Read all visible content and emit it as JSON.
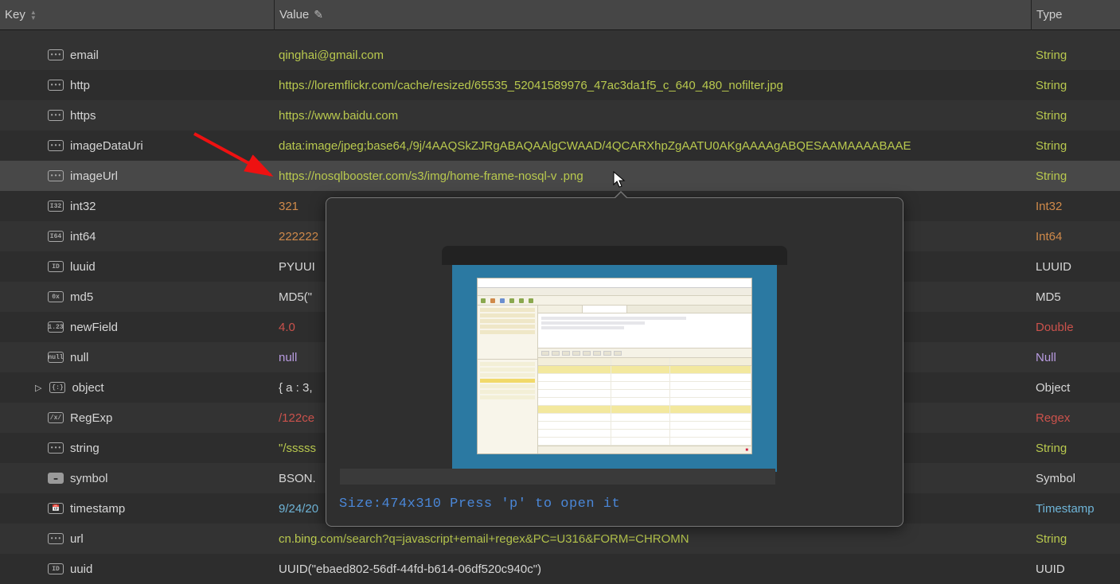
{
  "header": {
    "key": "Key",
    "value": "Value",
    "type": "Type"
  },
  "rows": [
    {
      "icon": "•••",
      "key": "email",
      "value": "qinghai@gmail.com",
      "valClass": "val-green",
      "type": "String",
      "typeClass": "type-green"
    },
    {
      "icon": "•••",
      "key": "http",
      "value": "https://loremflickr.com/cache/resized/65535_52041589976_47ac3da1f5_c_640_480_nofilter.jpg",
      "valClass": "val-green",
      "type": "String",
      "typeClass": "type-green"
    },
    {
      "icon": "•••",
      "key": "https",
      "value": "https://www.baidu.com",
      "valClass": "val-green",
      "type": "String",
      "typeClass": "type-green"
    },
    {
      "icon": "•••",
      "key": "imageDataUri",
      "value": "data:image/jpeg;base64,/9j/4AAQSkZJRgABAQAAlgCWAAD/4QCARXhpZgAATU0AKgAAAAgABQESAAMAAAABAAE",
      "valClass": "val-green",
      "type": "String",
      "typeClass": "type-green"
    },
    {
      "icon": "•••",
      "key": "imageUrl",
      "value": "https://nosqlbooster.com/s3/img/home-frame-nosql-v  .png",
      "valClass": "val-green",
      "type": "String",
      "typeClass": "type-green",
      "highlight": true
    },
    {
      "icon": "I32",
      "key": "int32",
      "value": "321",
      "valClass": "val-orange",
      "type": "Int32",
      "typeClass": "type-orange"
    },
    {
      "icon": "I64",
      "key": "int64",
      "value": "222222",
      "valClass": "val-orange",
      "type": "Int64",
      "typeClass": "type-orange"
    },
    {
      "icon": "ID",
      "key": "luuid",
      "value": "PYUUI",
      "valClass": "val-gray",
      "type": "LUUID",
      "typeClass": "type-gray"
    },
    {
      "icon": "0x",
      "key": "md5",
      "value": "MD5(\"",
      "valClass": "val-gray",
      "type": "MD5",
      "typeClass": "type-gray"
    },
    {
      "icon": "1.23",
      "key": "newField",
      "value": "4.0",
      "valClass": "val-red",
      "type": "Double",
      "typeClass": "type-red"
    },
    {
      "icon": "null",
      "key": "null",
      "value": "null",
      "valClass": "val-lav",
      "type": "Null",
      "typeClass": "type-lav"
    },
    {
      "icon": "{:}",
      "key": "object",
      "value": "{ a : 3,",
      "valClass": "val-gray",
      "type": "Object",
      "typeClass": "type-gray",
      "expandable": true
    },
    {
      "icon": "/x/",
      "key": "RegExp",
      "value": "/122ce",
      "valClass": "val-red",
      "type": "Regex",
      "typeClass": "type-red"
    },
    {
      "icon": "•••",
      "key": "string",
      "value": "\"/sssss",
      "valClass": "val-green",
      "type": "String",
      "typeClass": "type-green"
    },
    {
      "icon": "▬",
      "key": "symbol",
      "value": "BSON.",
      "valClass": "val-gray",
      "type": "Symbol",
      "typeClass": "type-gray",
      "filled": true
    },
    {
      "icon": "📅",
      "key": "timestamp",
      "value": "9/24/20",
      "valClass": "val-blue",
      "type": "Timestamp",
      "typeClass": "type-blue"
    },
    {
      "icon": "•••",
      "key": "url",
      "value": "cn.bing.com/search?q=javascript+email+regex&PC=U316&FORM=CHROMN",
      "valClass": "val-green",
      "type": "String",
      "typeClass": "type-green"
    },
    {
      "icon": "ID",
      "key": "uuid",
      "value": "UUID(\"ebaed802-56df-44fd-b614-06df520c940c\")",
      "valClass": "val-gray",
      "type": "UUID",
      "typeClass": "type-gray"
    }
  ],
  "popup": {
    "hint": "Size:474x310 Press 'p' to open it"
  }
}
